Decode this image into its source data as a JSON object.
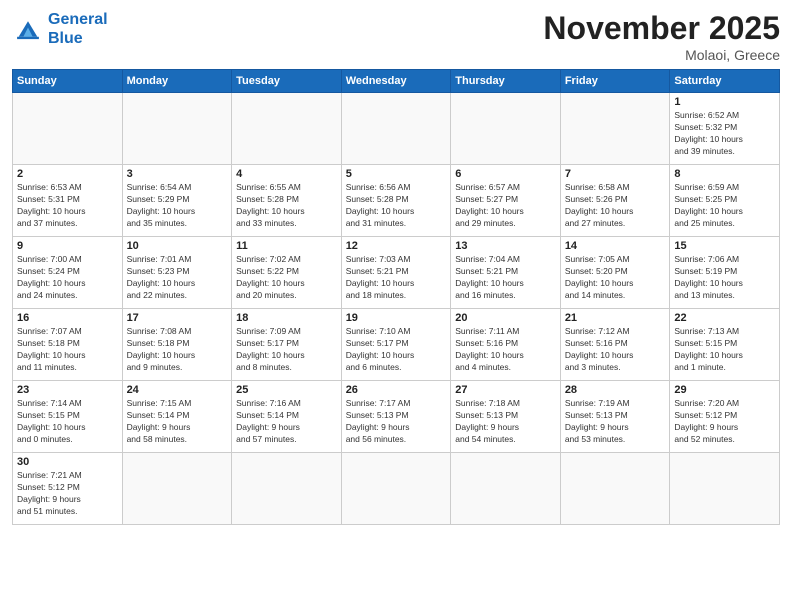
{
  "header": {
    "logo_line1": "General",
    "logo_line2": "Blue",
    "month_title": "November 2025",
    "location": "Molaoi, Greece"
  },
  "weekdays": [
    "Sunday",
    "Monday",
    "Tuesday",
    "Wednesday",
    "Thursday",
    "Friday",
    "Saturday"
  ],
  "weeks": [
    [
      {
        "day": "",
        "info": ""
      },
      {
        "day": "",
        "info": ""
      },
      {
        "day": "",
        "info": ""
      },
      {
        "day": "",
        "info": ""
      },
      {
        "day": "",
        "info": ""
      },
      {
        "day": "",
        "info": ""
      },
      {
        "day": "1",
        "info": "Sunrise: 6:52 AM\nSunset: 5:32 PM\nDaylight: 10 hours\nand 39 minutes."
      }
    ],
    [
      {
        "day": "2",
        "info": "Sunrise: 6:53 AM\nSunset: 5:31 PM\nDaylight: 10 hours\nand 37 minutes."
      },
      {
        "day": "3",
        "info": "Sunrise: 6:54 AM\nSunset: 5:29 PM\nDaylight: 10 hours\nand 35 minutes."
      },
      {
        "day": "4",
        "info": "Sunrise: 6:55 AM\nSunset: 5:28 PM\nDaylight: 10 hours\nand 33 minutes."
      },
      {
        "day": "5",
        "info": "Sunrise: 6:56 AM\nSunset: 5:28 PM\nDaylight: 10 hours\nand 31 minutes."
      },
      {
        "day": "6",
        "info": "Sunrise: 6:57 AM\nSunset: 5:27 PM\nDaylight: 10 hours\nand 29 minutes."
      },
      {
        "day": "7",
        "info": "Sunrise: 6:58 AM\nSunset: 5:26 PM\nDaylight: 10 hours\nand 27 minutes."
      },
      {
        "day": "8",
        "info": "Sunrise: 6:59 AM\nSunset: 5:25 PM\nDaylight: 10 hours\nand 25 minutes."
      }
    ],
    [
      {
        "day": "9",
        "info": "Sunrise: 7:00 AM\nSunset: 5:24 PM\nDaylight: 10 hours\nand 24 minutes."
      },
      {
        "day": "10",
        "info": "Sunrise: 7:01 AM\nSunset: 5:23 PM\nDaylight: 10 hours\nand 22 minutes."
      },
      {
        "day": "11",
        "info": "Sunrise: 7:02 AM\nSunset: 5:22 PM\nDaylight: 10 hours\nand 20 minutes."
      },
      {
        "day": "12",
        "info": "Sunrise: 7:03 AM\nSunset: 5:21 PM\nDaylight: 10 hours\nand 18 minutes."
      },
      {
        "day": "13",
        "info": "Sunrise: 7:04 AM\nSunset: 5:21 PM\nDaylight: 10 hours\nand 16 minutes."
      },
      {
        "day": "14",
        "info": "Sunrise: 7:05 AM\nSunset: 5:20 PM\nDaylight: 10 hours\nand 14 minutes."
      },
      {
        "day": "15",
        "info": "Sunrise: 7:06 AM\nSunset: 5:19 PM\nDaylight: 10 hours\nand 13 minutes."
      }
    ],
    [
      {
        "day": "16",
        "info": "Sunrise: 7:07 AM\nSunset: 5:18 PM\nDaylight: 10 hours\nand 11 minutes."
      },
      {
        "day": "17",
        "info": "Sunrise: 7:08 AM\nSunset: 5:18 PM\nDaylight: 10 hours\nand 9 minutes."
      },
      {
        "day": "18",
        "info": "Sunrise: 7:09 AM\nSunset: 5:17 PM\nDaylight: 10 hours\nand 8 minutes."
      },
      {
        "day": "19",
        "info": "Sunrise: 7:10 AM\nSunset: 5:17 PM\nDaylight: 10 hours\nand 6 minutes."
      },
      {
        "day": "20",
        "info": "Sunrise: 7:11 AM\nSunset: 5:16 PM\nDaylight: 10 hours\nand 4 minutes."
      },
      {
        "day": "21",
        "info": "Sunrise: 7:12 AM\nSunset: 5:16 PM\nDaylight: 10 hours\nand 3 minutes."
      },
      {
        "day": "22",
        "info": "Sunrise: 7:13 AM\nSunset: 5:15 PM\nDaylight: 10 hours\nand 1 minute."
      }
    ],
    [
      {
        "day": "23",
        "info": "Sunrise: 7:14 AM\nSunset: 5:15 PM\nDaylight: 10 hours\nand 0 minutes."
      },
      {
        "day": "24",
        "info": "Sunrise: 7:15 AM\nSunset: 5:14 PM\nDaylight: 9 hours\nand 58 minutes."
      },
      {
        "day": "25",
        "info": "Sunrise: 7:16 AM\nSunset: 5:14 PM\nDaylight: 9 hours\nand 57 minutes."
      },
      {
        "day": "26",
        "info": "Sunrise: 7:17 AM\nSunset: 5:13 PM\nDaylight: 9 hours\nand 56 minutes."
      },
      {
        "day": "27",
        "info": "Sunrise: 7:18 AM\nSunset: 5:13 PM\nDaylight: 9 hours\nand 54 minutes."
      },
      {
        "day": "28",
        "info": "Sunrise: 7:19 AM\nSunset: 5:13 PM\nDaylight: 9 hours\nand 53 minutes."
      },
      {
        "day": "29",
        "info": "Sunrise: 7:20 AM\nSunset: 5:12 PM\nDaylight: 9 hours\nand 52 minutes."
      }
    ],
    [
      {
        "day": "30",
        "info": "Sunrise: 7:21 AM\nSunset: 5:12 PM\nDaylight: 9 hours\nand 51 minutes."
      },
      {
        "day": "",
        "info": ""
      },
      {
        "day": "",
        "info": ""
      },
      {
        "day": "",
        "info": ""
      },
      {
        "day": "",
        "info": ""
      },
      {
        "day": "",
        "info": ""
      },
      {
        "day": "",
        "info": ""
      }
    ]
  ]
}
